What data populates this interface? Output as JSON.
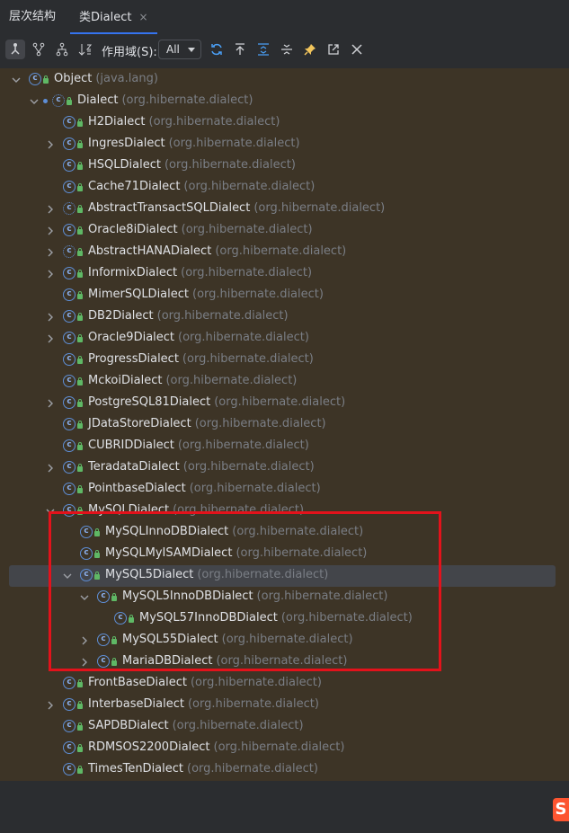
{
  "tabs": [
    {
      "label": "层次结构",
      "active": false
    },
    {
      "label": "类Dialect",
      "active": true,
      "close": "×"
    }
  ],
  "toolbar": {
    "scope_label": "作用域(S):",
    "scope_value": "All",
    "buttons": [
      "subtypes-hierarchy-icon",
      "supertypes-hierarchy-icon",
      "class-hierarchy-icon",
      "sort-alpha-icon",
      "refresh-icon",
      "export-icon",
      "expand-all-icon",
      "collapse-all-icon",
      "pin-icon",
      "open-in-window-icon",
      "close-icon"
    ]
  },
  "tree": [
    {
      "indent": 0,
      "expand": "open",
      "icon": "class",
      "name": "Object",
      "pkg": "(java.lang)"
    },
    {
      "indent": 1,
      "expand": "open",
      "icon": "abstract",
      "dot": true,
      "name": "Dialect",
      "pkg": "(org.hibernate.dialect)"
    },
    {
      "indent": 2,
      "expand": "none",
      "icon": "class",
      "name": "H2Dialect",
      "pkg": "(org.hibernate.dialect)"
    },
    {
      "indent": 2,
      "expand": "closed",
      "icon": "class",
      "name": "IngresDialect",
      "pkg": "(org.hibernate.dialect)"
    },
    {
      "indent": 2,
      "expand": "none",
      "icon": "class",
      "name": "HSQLDialect",
      "pkg": "(org.hibernate.dialect)"
    },
    {
      "indent": 2,
      "expand": "none",
      "icon": "class",
      "name": "Cache71Dialect",
      "pkg": "(org.hibernate.dialect)"
    },
    {
      "indent": 2,
      "expand": "closed",
      "icon": "abstract",
      "name": "AbstractTransactSQLDialect",
      "pkg": "(org.hibernate.dialect)"
    },
    {
      "indent": 2,
      "expand": "closed",
      "icon": "class",
      "name": "Oracle8iDialect",
      "pkg": "(org.hibernate.dialect)"
    },
    {
      "indent": 2,
      "expand": "closed",
      "icon": "abstract",
      "name": "AbstractHANADialect",
      "pkg": "(org.hibernate.dialect)"
    },
    {
      "indent": 2,
      "expand": "closed",
      "icon": "class",
      "name": "InformixDialect",
      "pkg": "(org.hibernate.dialect)"
    },
    {
      "indent": 2,
      "expand": "none",
      "icon": "class",
      "name": "MimerSQLDialect",
      "pkg": "(org.hibernate.dialect)"
    },
    {
      "indent": 2,
      "expand": "closed",
      "icon": "class",
      "name": "DB2Dialect",
      "pkg": "(org.hibernate.dialect)"
    },
    {
      "indent": 2,
      "expand": "closed",
      "icon": "class",
      "name": "Oracle9Dialect",
      "pkg": "(org.hibernate.dialect)"
    },
    {
      "indent": 2,
      "expand": "none",
      "icon": "class",
      "name": "ProgressDialect",
      "pkg": "(org.hibernate.dialect)"
    },
    {
      "indent": 2,
      "expand": "none",
      "icon": "class",
      "name": "MckoiDialect",
      "pkg": "(org.hibernate.dialect)"
    },
    {
      "indent": 2,
      "expand": "closed",
      "icon": "class",
      "name": "PostgreSQL81Dialect",
      "pkg": "(org.hibernate.dialect)"
    },
    {
      "indent": 2,
      "expand": "none",
      "icon": "class",
      "name": "JDataStoreDialect",
      "pkg": "(org.hibernate.dialect)"
    },
    {
      "indent": 2,
      "expand": "none",
      "icon": "class",
      "name": "CUBRIDDialect",
      "pkg": "(org.hibernate.dialect)"
    },
    {
      "indent": 2,
      "expand": "closed",
      "icon": "class",
      "name": "TeradataDialect",
      "pkg": "(org.hibernate.dialect)"
    },
    {
      "indent": 2,
      "expand": "none",
      "icon": "class",
      "name": "PointbaseDialect",
      "pkg": "(org.hibernate.dialect)"
    },
    {
      "indent": 2,
      "expand": "open",
      "icon": "class",
      "name": "MySQLDialect",
      "pkg": "(org.hibernate.dialect)"
    },
    {
      "indent": 3,
      "expand": "none",
      "icon": "class",
      "name": "MySQLInnoDBDialect",
      "pkg": "(org.hibernate.dialect)"
    },
    {
      "indent": 3,
      "expand": "none",
      "icon": "class",
      "name": "MySQLMyISAMDialect",
      "pkg": "(org.hibernate.dialect)"
    },
    {
      "indent": 3,
      "expand": "open",
      "icon": "class",
      "name": "MySQL5Dialect",
      "pkg": "(org.hibernate.dialect)",
      "selected": true
    },
    {
      "indent": 4,
      "expand": "open",
      "icon": "class",
      "name": "MySQL5InnoDBDialect",
      "pkg": "(org.hibernate.dialect)"
    },
    {
      "indent": 5,
      "expand": "none",
      "icon": "class",
      "name": "MySQL57InnoDBDialect",
      "pkg": "(org.hibernate.dialect)"
    },
    {
      "indent": 4,
      "expand": "closed",
      "icon": "class",
      "name": "MySQL55Dialect",
      "pkg": "(org.hibernate.dialect)"
    },
    {
      "indent": 4,
      "expand": "closed",
      "icon": "class",
      "name": "MariaDBDialect",
      "pkg": "(org.hibernate.dialect)"
    },
    {
      "indent": 2,
      "expand": "none",
      "icon": "class",
      "name": "FrontBaseDialect",
      "pkg": "(org.hibernate.dialect)"
    },
    {
      "indent": 2,
      "expand": "closed",
      "icon": "class",
      "name": "InterbaseDialect",
      "pkg": "(org.hibernate.dialect)"
    },
    {
      "indent": 2,
      "expand": "none",
      "icon": "class",
      "name": "SAPDBDialect",
      "pkg": "(org.hibernate.dialect)"
    },
    {
      "indent": 2,
      "expand": "none",
      "icon": "class",
      "name": "RDMSOS2200Dialect",
      "pkg": "(org.hibernate.dialect)"
    },
    {
      "indent": 2,
      "expand": "none",
      "icon": "class",
      "name": "TimesTenDialect",
      "pkg": "(org.hibernate.dialect)"
    }
  ],
  "watermark": "S"
}
